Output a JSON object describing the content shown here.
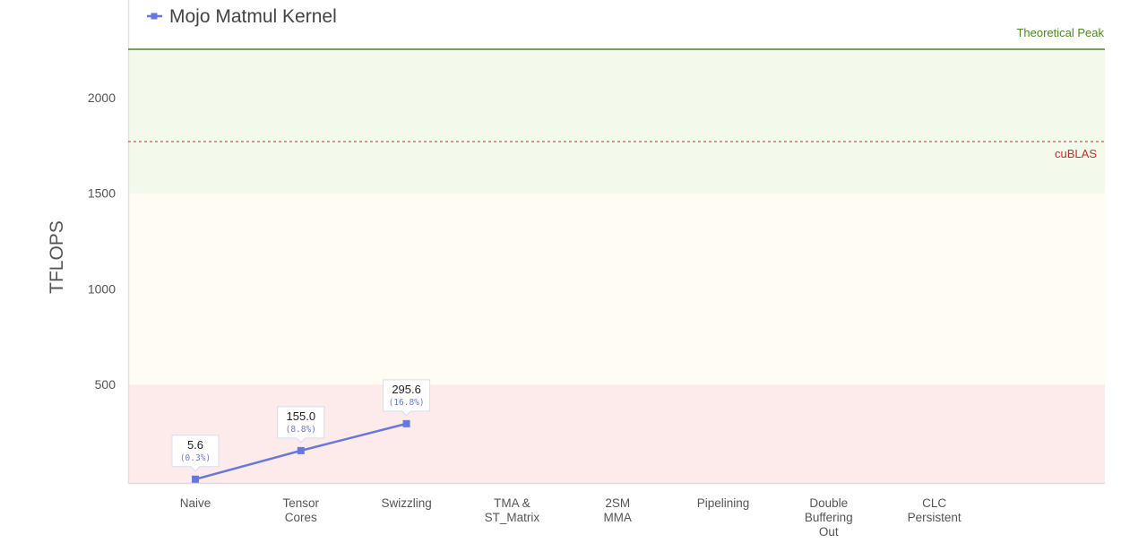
{
  "chart_data": {
    "type": "line",
    "ylabel": "TFLOPS",
    "xlabel": "",
    "ylim": [
      0,
      2250
    ],
    "yticks": [
      500,
      1000,
      1500,
      2000
    ],
    "categories": [
      [
        "Naive"
      ],
      [
        "Tensor",
        "Cores"
      ],
      [
        "Swizzling"
      ],
      [
        "TMA &",
        "ST_Matrix"
      ],
      [
        "2SM",
        "MMA"
      ],
      [
        "Pipelining"
      ],
      [
        "Double",
        "Buffering",
        "Out"
      ],
      [
        "CLC",
        "Persistent"
      ]
    ],
    "series": [
      {
        "name": "Mojo Matmul Kernel",
        "color": "#6678e0",
        "values": [
          5.6,
          155.0,
          295.6
        ],
        "labels": [
          "5.6",
          "155.0",
          "295.6"
        ],
        "pct_labels": [
          "(0.3%)",
          "(8.8%)",
          "(16.8%)"
        ]
      }
    ],
    "reference_lines": [
      {
        "label": "Theoretical Peak",
        "value": 2250,
        "color": "#4a8a1e",
        "style": "solid"
      },
      {
        "label": "cuBLAS",
        "value": 1770,
        "color": "#cc2a2a",
        "style": "dashed"
      }
    ],
    "bands": [
      {
        "from": 0,
        "to": 500,
        "color": "#fdebec"
      },
      {
        "from": 500,
        "to": 1500,
        "color": "#fefcf3"
      },
      {
        "from": 1500,
        "to": 2250,
        "color": "#f3faec"
      }
    ],
    "legend_position": "top-left",
    "grid": false
  }
}
